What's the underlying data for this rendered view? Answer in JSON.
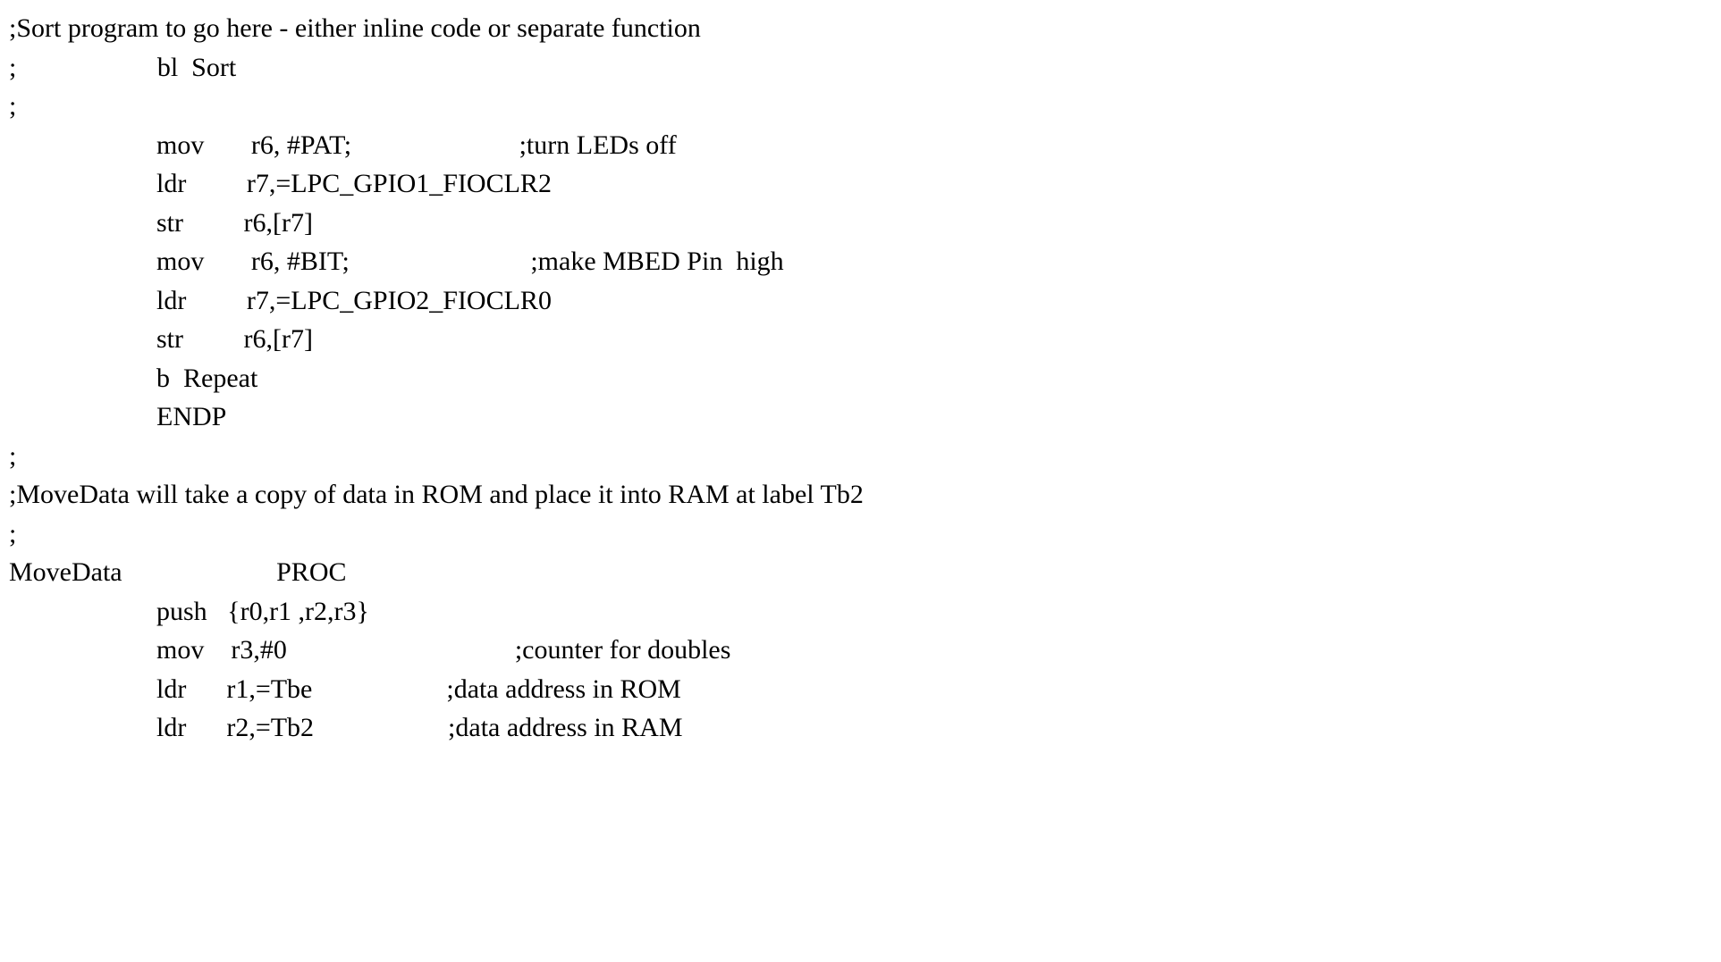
{
  "lines": [
    ";Sort program to go here - either inline code or separate function",
    ";                     bl  Sort",
    ";",
    "                      mov       r6, #PAT;                         ;turn LEDs off",
    "                      ldr         r7,=LPC_GPIO1_FIOCLR2",
    "                      str         r6,[r7]",
    "                      mov       r6, #BIT;                           ;make MBED Pin  high",
    "                      ldr         r7,=LPC_GPIO2_FIOCLR0",
    "                      str         r6,[r7]",
    "                      b  Repeat",
    "                      ENDP",
    ";",
    ";MoveData will take a copy of data in ROM and place it into RAM at label Tb2",
    ";",
    "MoveData                       PROC",
    "                      push   {r0,r1 ,r2,r3}",
    "                      mov    r3,#0                                  ;counter for doubles",
    "                      ldr      r1,=Tbe                    ;data address in ROM",
    "                      ldr      r2,=Tb2                    ;data address in RAM"
  ]
}
